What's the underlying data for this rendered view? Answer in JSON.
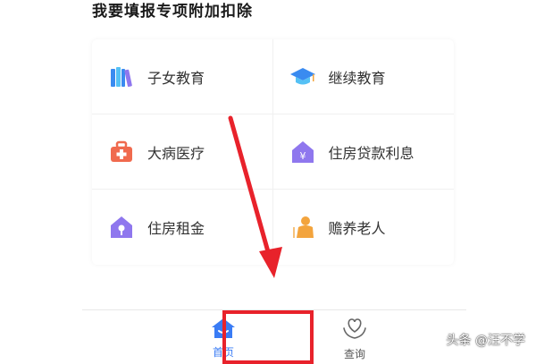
{
  "section": {
    "title": "我要填报专项附加扣除"
  },
  "items": [
    {
      "label": "子女教育",
      "icon": "books-icon"
    },
    {
      "label": "继续教育",
      "icon": "graduation-cap-icon"
    },
    {
      "label": "大病医疗",
      "icon": "medical-kit-icon"
    },
    {
      "label": "住房贷款利息",
      "icon": "house-loan-icon"
    },
    {
      "label": "住房租金",
      "icon": "house-rent-icon"
    },
    {
      "label": "赡养老人",
      "icon": "elderly-icon"
    }
  ],
  "tabs": [
    {
      "label": "首页",
      "icon": "home-icon"
    },
    {
      "label": "查询",
      "icon": "heart-hands-icon"
    }
  ],
  "watermark": {
    "text": "头条 @汪不学"
  },
  "colors": {
    "accent": "#3a7cf5",
    "annotation_red": "#e8222b",
    "purple_icon": "#8f77ee",
    "orange_icon": "#f3a43d",
    "red_icon": "#f06a4e"
  }
}
